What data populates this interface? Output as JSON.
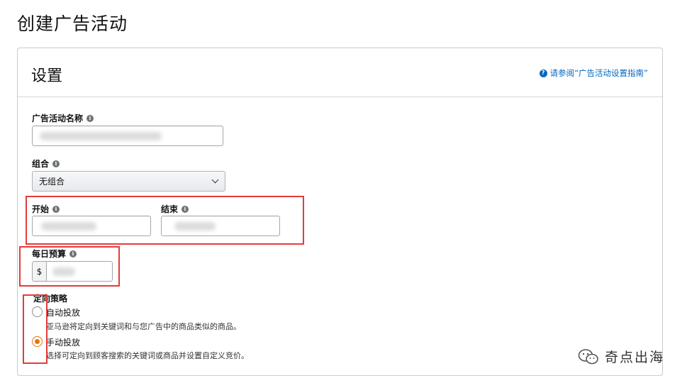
{
  "page": {
    "title": "创建广告活动"
  },
  "panel": {
    "title": "设置",
    "guide_link": "请参阅“广告活动设置指南”"
  },
  "fields": {
    "campaign_name": {
      "label": "广告活动名称",
      "value": ""
    },
    "portfolio": {
      "label": "组合",
      "selected": "无组合"
    },
    "start": {
      "label": "开始",
      "value": ""
    },
    "end": {
      "label": "结束",
      "value": ""
    },
    "daily_budget": {
      "label": "每日预算",
      "currency": "$",
      "value": ""
    }
  },
  "targeting": {
    "label": "定向策略",
    "options": [
      {
        "title": "自动投放",
        "description": "亚马逊将定向到关键词和与您广告中的商品类似的商品。",
        "checked": false
      },
      {
        "title": "手动投放",
        "description": "选择可定向到顾客搜索的关键词或商品并设置自定义竞价。",
        "checked": true
      }
    ]
  },
  "watermark": {
    "text": "奇点出海"
  },
  "colors": {
    "accent": "#e77600",
    "link": "#0066c0",
    "highlight": "#e23c3c"
  }
}
